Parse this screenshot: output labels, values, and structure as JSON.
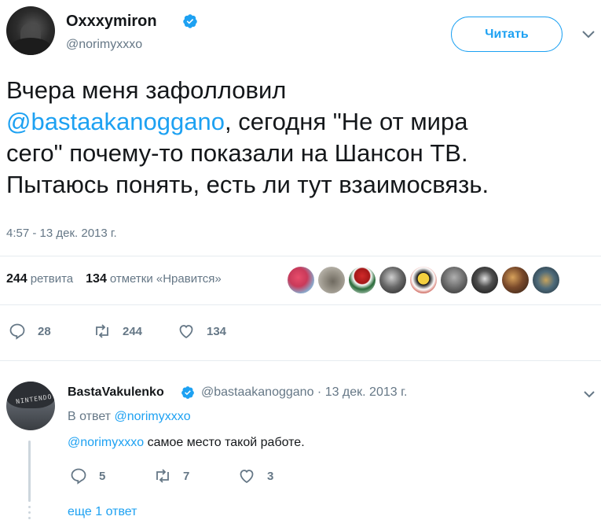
{
  "tweet": {
    "display_name": "Oxxxymiron",
    "handle": "@norimyxxxo",
    "follow_label": "Читать",
    "text_line1": "Вчера меня зафолловил",
    "mention": "@bastaakanoggano",
    "text_line2_rest": ", сегодня \"Не от мира",
    "text_line3": "сего\" почему-то показали на Шансон ТВ.",
    "text_line4": "Пытаюсь понять, есть ли тут взаимосвязь.",
    "timestamp": "4:57 - 13 дек. 2013 г."
  },
  "stats": {
    "retweets_count": "244",
    "retweets_label": "ретвита",
    "likes_count": "134",
    "likes_label": "отметки «Нравится»"
  },
  "actions": {
    "replies": "28",
    "retweets": "244",
    "likes": "134"
  },
  "reply": {
    "display_name": "BastaVakulenko",
    "handle_date": "@bastaakanoggano · 13 дек. 2013 г.",
    "replying_prefix": "В ответ ",
    "replying_to": "@norimyxxxo",
    "mention": "@norimyxxxo",
    "text": " самое место такой работе.",
    "replies": "5",
    "retweets": "7",
    "likes": "3",
    "avatar_cap_text": "NINTENDO"
  },
  "more_replies": "еще 1 ответ",
  "colors": {
    "accent": "#1da1f2",
    "muted": "#657786",
    "text": "#14171a",
    "divider": "#e6ecf0"
  }
}
